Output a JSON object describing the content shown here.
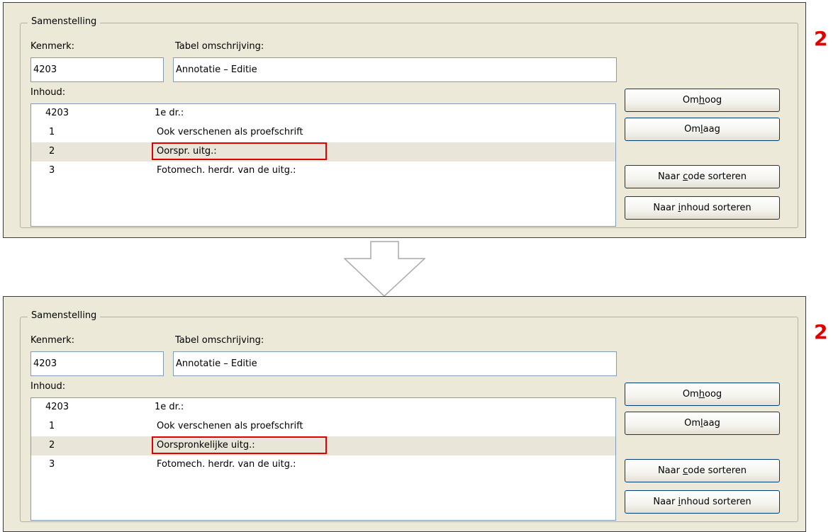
{
  "marker": "2",
  "panels": [
    {
      "group_title": "Samenstelling",
      "kenmerk_label": "Kenmerk:",
      "kenmerk_value": "4203",
      "tabel_label": "Tabel omschrijving:",
      "tabel_value": "Annotatie – Editie",
      "inhoud_label": "Inhoud:",
      "rows": [
        {
          "code": "4203",
          "desc": "1e dr.:"
        },
        {
          "code": "1",
          "desc": "Ook verschenen als proefschrift"
        },
        {
          "code": "2",
          "desc": "Oorspr. uitg.:"
        },
        {
          "code": "3",
          "desc": "Fotomech. herdr. van de uitg.:"
        }
      ],
      "selected_row": 2,
      "buttons": {
        "up": {
          "pre": "Om",
          "key": "h",
          "post": "oog"
        },
        "down": {
          "pre": "Om",
          "key": "l",
          "post": "aag"
        },
        "sort_code": {
          "pre": "Naar ",
          "key": "c",
          "post": "ode sorteren"
        },
        "sort_content": {
          "pre": "Naar ",
          "key": "i",
          "post": "nhoud sorteren"
        }
      }
    },
    {
      "group_title": "Samenstelling",
      "kenmerk_label": "Kenmerk:",
      "kenmerk_value": "4203",
      "tabel_label": "Tabel omschrijving:",
      "tabel_value": "Annotatie – Editie",
      "inhoud_label": "Inhoud:",
      "rows": [
        {
          "code": "4203",
          "desc": "1e dr.:"
        },
        {
          "code": "1",
          "desc": "Ook verschenen als proefschrift"
        },
        {
          "code": "2",
          "desc": "Oorspronkelijke uitg.:"
        },
        {
          "code": "3",
          "desc": "Fotomech. herdr. van de uitg.:"
        }
      ],
      "selected_row": 2,
      "buttons": {
        "up": {
          "pre": "Om",
          "key": "h",
          "post": "oog"
        },
        "down": {
          "pre": "Om",
          "key": "l",
          "post": "aag"
        },
        "sort_code": {
          "pre": "Naar ",
          "key": "c",
          "post": "ode sorteren"
        },
        "sort_content": {
          "pre": "Naar ",
          "key": "i",
          "post": "nhoud sorteren"
        }
      }
    }
  ],
  "colors": {
    "highlight": "#e00000",
    "panel_bg": "#ece9d8",
    "selected_row_bg": "#e9e5d9"
  },
  "icons": {
    "transition_arrow": "down-arrow-outline-icon"
  }
}
